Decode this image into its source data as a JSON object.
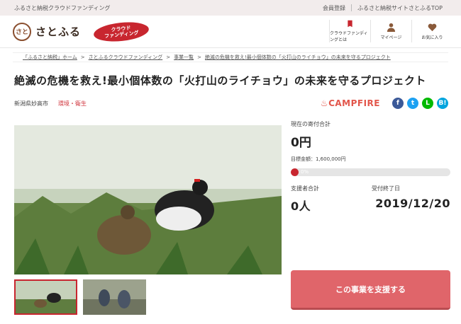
{
  "topbar": {
    "site_label": "ふるさと納税クラウドファンディング",
    "register": "会員登録",
    "top_link": "ふるさと納税サイトさとふるTOP"
  },
  "header": {
    "logo_text": "さとふる",
    "logo_seal": "さと",
    "badge_line1": "クラウド",
    "badge_line2": "ファンディング",
    "nav": [
      {
        "label": "クラウドファンディングとは",
        "icon": "book-icon"
      },
      {
        "label": "マイページ",
        "icon": "person-icon"
      },
      {
        "label": "お気に入り",
        "icon": "heart-icon"
      }
    ]
  },
  "breadcrumb": [
    "「ふるさと納税」ホーム",
    "さとふるクラウドファンディング",
    "事業一覧",
    "絶滅の危機を救え!最小個体数の「火打山のライチョウ」の未来を守るプロジェクト"
  ],
  "project": {
    "title": "絶滅の危機を救え!最小個体数の「火打山のライチョウ」の未来を守るプロジェクト",
    "location": "新潟県妙高市",
    "category": "環境・衛生",
    "partner": "CAMPFIRE",
    "share": [
      {
        "icon": "facebook-icon",
        "glyph": "f",
        "color": "#3b5998"
      },
      {
        "icon": "twitter-icon",
        "glyph": "t",
        "color": "#1da1f2"
      },
      {
        "icon": "line-icon",
        "glyph": "L",
        "color": "#00b900"
      },
      {
        "icon": "hatena-icon",
        "glyph": "B!",
        "color": "#00a4de"
      }
    ]
  },
  "funding": {
    "current_label": "現在の寄付合計",
    "current_amount": "0円",
    "target_text": "目標金額：1,600,000円",
    "progress_label": "0%",
    "progress_fraction": 0,
    "supporters_label": "支援者合計",
    "supporters": "0人",
    "deadline_label": "受付終了日",
    "deadline": "2019/12/20",
    "support_button": "この事業を支援する"
  },
  "colors": {
    "accent": "#c8262f",
    "button": "#e0656a"
  }
}
